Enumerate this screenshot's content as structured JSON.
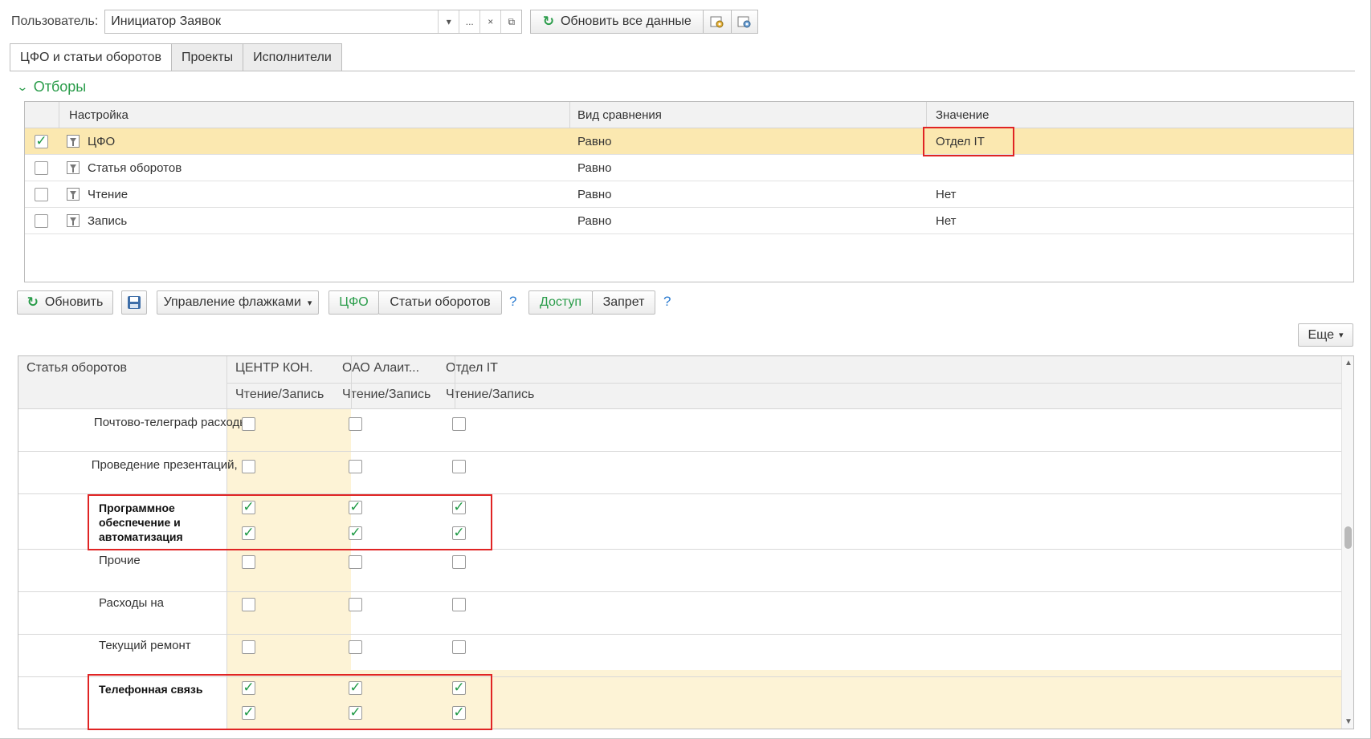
{
  "header": {
    "user_label": "Пользователь:",
    "user_value": "Инициатор Заявок",
    "dropdown_glyph": "▾",
    "more_glyph": "...",
    "clear_glyph": "×",
    "open_glyph": "⧉",
    "refresh_all_label": "Обновить все данные"
  },
  "tabs": [
    {
      "label": "ЦФО и статьи оборотов",
      "active": true
    },
    {
      "label": "Проекты",
      "active": false
    },
    {
      "label": "Исполнители",
      "active": false
    }
  ],
  "filters": {
    "title": "Отборы",
    "columns": {
      "setting": "Настройка",
      "comparison": "Вид сравнения",
      "value": "Значение"
    },
    "rows": [
      {
        "checked": true,
        "name": "ЦФО",
        "comparison": "Равно",
        "value": "Отдел IT",
        "selected": true
      },
      {
        "checked": false,
        "name": "Статья оборотов",
        "comparison": "Равно",
        "value": ""
      },
      {
        "checked": false,
        "name": "Чтение",
        "comparison": "Равно",
        "value": "Нет"
      },
      {
        "checked": false,
        "name": "Запись",
        "comparison": "Равно",
        "value": "Нет"
      }
    ]
  },
  "toolbar": {
    "refresh_label": "Обновить",
    "flags_label": "Управление флажками",
    "flags_arrow": "▾",
    "cfo_label": "ЦФО",
    "articles_label": "Статьи оборотов",
    "help1": "?",
    "access_label": "Доступ",
    "deny_label": "Запрет",
    "help2": "?",
    "more_label": "Еще",
    "more_arrow": "▾"
  },
  "grid": {
    "first_col_header": "Статья оборотов",
    "columns": [
      {
        "name": "ЦЕНТР КОН.",
        "sub": "Чтение/Запись"
      },
      {
        "name": "ОАО Алаит...",
        "sub": "Чтение/Запись"
      },
      {
        "name": "Отдел IT",
        "sub": "Чтение/Запись"
      }
    ],
    "rows": [
      {
        "label": "Почтово-телеграф расходы",
        "bold": false,
        "checks": [
          [
            false
          ],
          [
            false
          ],
          [
            false
          ]
        ]
      },
      {
        "label": "Проведение презентаций, ...",
        "bold": false,
        "checks": [
          [
            false
          ],
          [
            false
          ],
          [
            false
          ]
        ]
      },
      {
        "label": "Программное обеспечение и автоматизация",
        "bold": true,
        "checks": [
          [
            true,
            true
          ],
          [
            true,
            true
          ],
          [
            true,
            true
          ]
        ]
      },
      {
        "label": "Прочие",
        "bold": false,
        "checks": [
          [
            false
          ],
          [
            false
          ],
          [
            false
          ]
        ]
      },
      {
        "label": "Расходы на",
        "bold": false,
        "checks": [
          [
            false
          ],
          [
            false
          ],
          [
            false
          ]
        ]
      },
      {
        "label": "Текущий ремонт",
        "bold": false,
        "checks": [
          [
            false
          ],
          [
            false
          ],
          [
            false
          ]
        ]
      },
      {
        "label": "Телефонная связь",
        "bold": true,
        "checks": [
          [
            true,
            true
          ],
          [
            true,
            true
          ],
          [
            true,
            true
          ]
        ]
      }
    ]
  },
  "colors": {
    "accent_green": "#2a9c4a",
    "selected_row": "#fbe8b0",
    "column_highlight": "#fdf3d6",
    "annotation_red": "#e02424",
    "help_blue": "#2b7bd0"
  }
}
